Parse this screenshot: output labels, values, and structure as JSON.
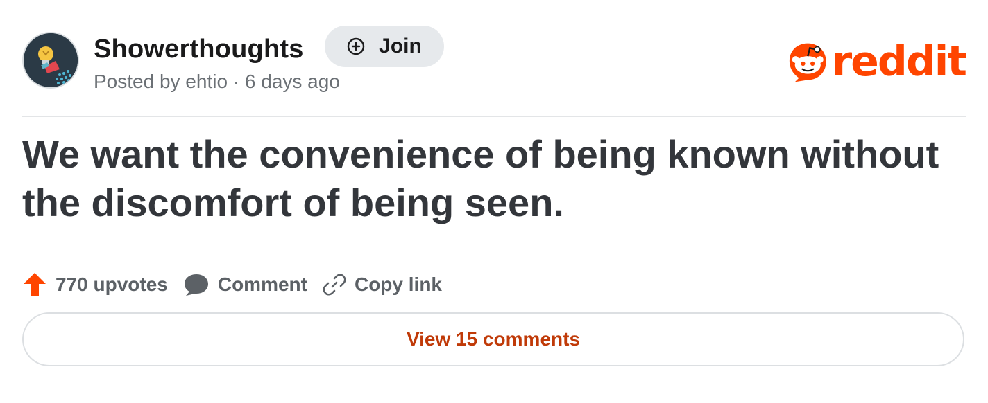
{
  "post": {
    "subreddit": "Showerthoughts",
    "join_label": "Join",
    "posted_by": "Posted by ehtio · 6 days ago",
    "title": "We want the convenience of being known without the discomfort of being seen.",
    "upvotes_label": "770 upvotes",
    "comment_label": "Comment",
    "copy_link_label": "Copy link",
    "view_comments_label": "View 15 comments"
  },
  "brand": {
    "wordmark": "reddit",
    "color": "#ff4500"
  },
  "icons": {
    "avatar": "lightbulb-shower-icon",
    "join": "plus-circle-icon",
    "upvote": "upvote-arrow-icon",
    "comment": "comment-bubble-icon",
    "copy_link": "link-icon",
    "logo": "reddit-snoo-icon"
  },
  "colors": {
    "accent": "#ff4500",
    "view_comments_text": "#c03a08",
    "title_text": "#33363b",
    "meta_text": "#6b7075"
  }
}
